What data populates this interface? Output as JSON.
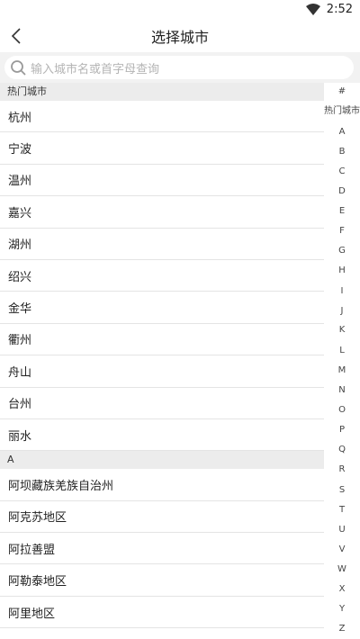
{
  "status_bar": {
    "time": "2:52",
    "icon": "wifi-icon"
  },
  "nav": {
    "title": "选择城市",
    "back_icon": "back-chevron-icon"
  },
  "search": {
    "placeholder": "输入城市名或首字母查询",
    "icon": "search-icon"
  },
  "sections": [
    {
      "header": "热门城市",
      "cities": [
        "杭州",
        "宁波",
        "温州",
        "嘉兴",
        "湖州",
        "绍兴",
        "金华",
        "衢州",
        "舟山",
        "台州",
        "丽水"
      ]
    },
    {
      "header": "A",
      "cities": [
        "阿坝藏族羌族自治州",
        "阿克苏地区",
        "阿拉善盟",
        "阿勒泰地区",
        "阿里地区"
      ]
    }
  ],
  "index": [
    "#",
    "热门城市",
    "A",
    "B",
    "C",
    "D",
    "E",
    "F",
    "G",
    "H",
    "I",
    "J",
    "K",
    "L",
    "M",
    "N",
    "O",
    "P",
    "Q",
    "R",
    "S",
    "T",
    "U",
    "V",
    "W",
    "X",
    "Y",
    "Z"
  ]
}
